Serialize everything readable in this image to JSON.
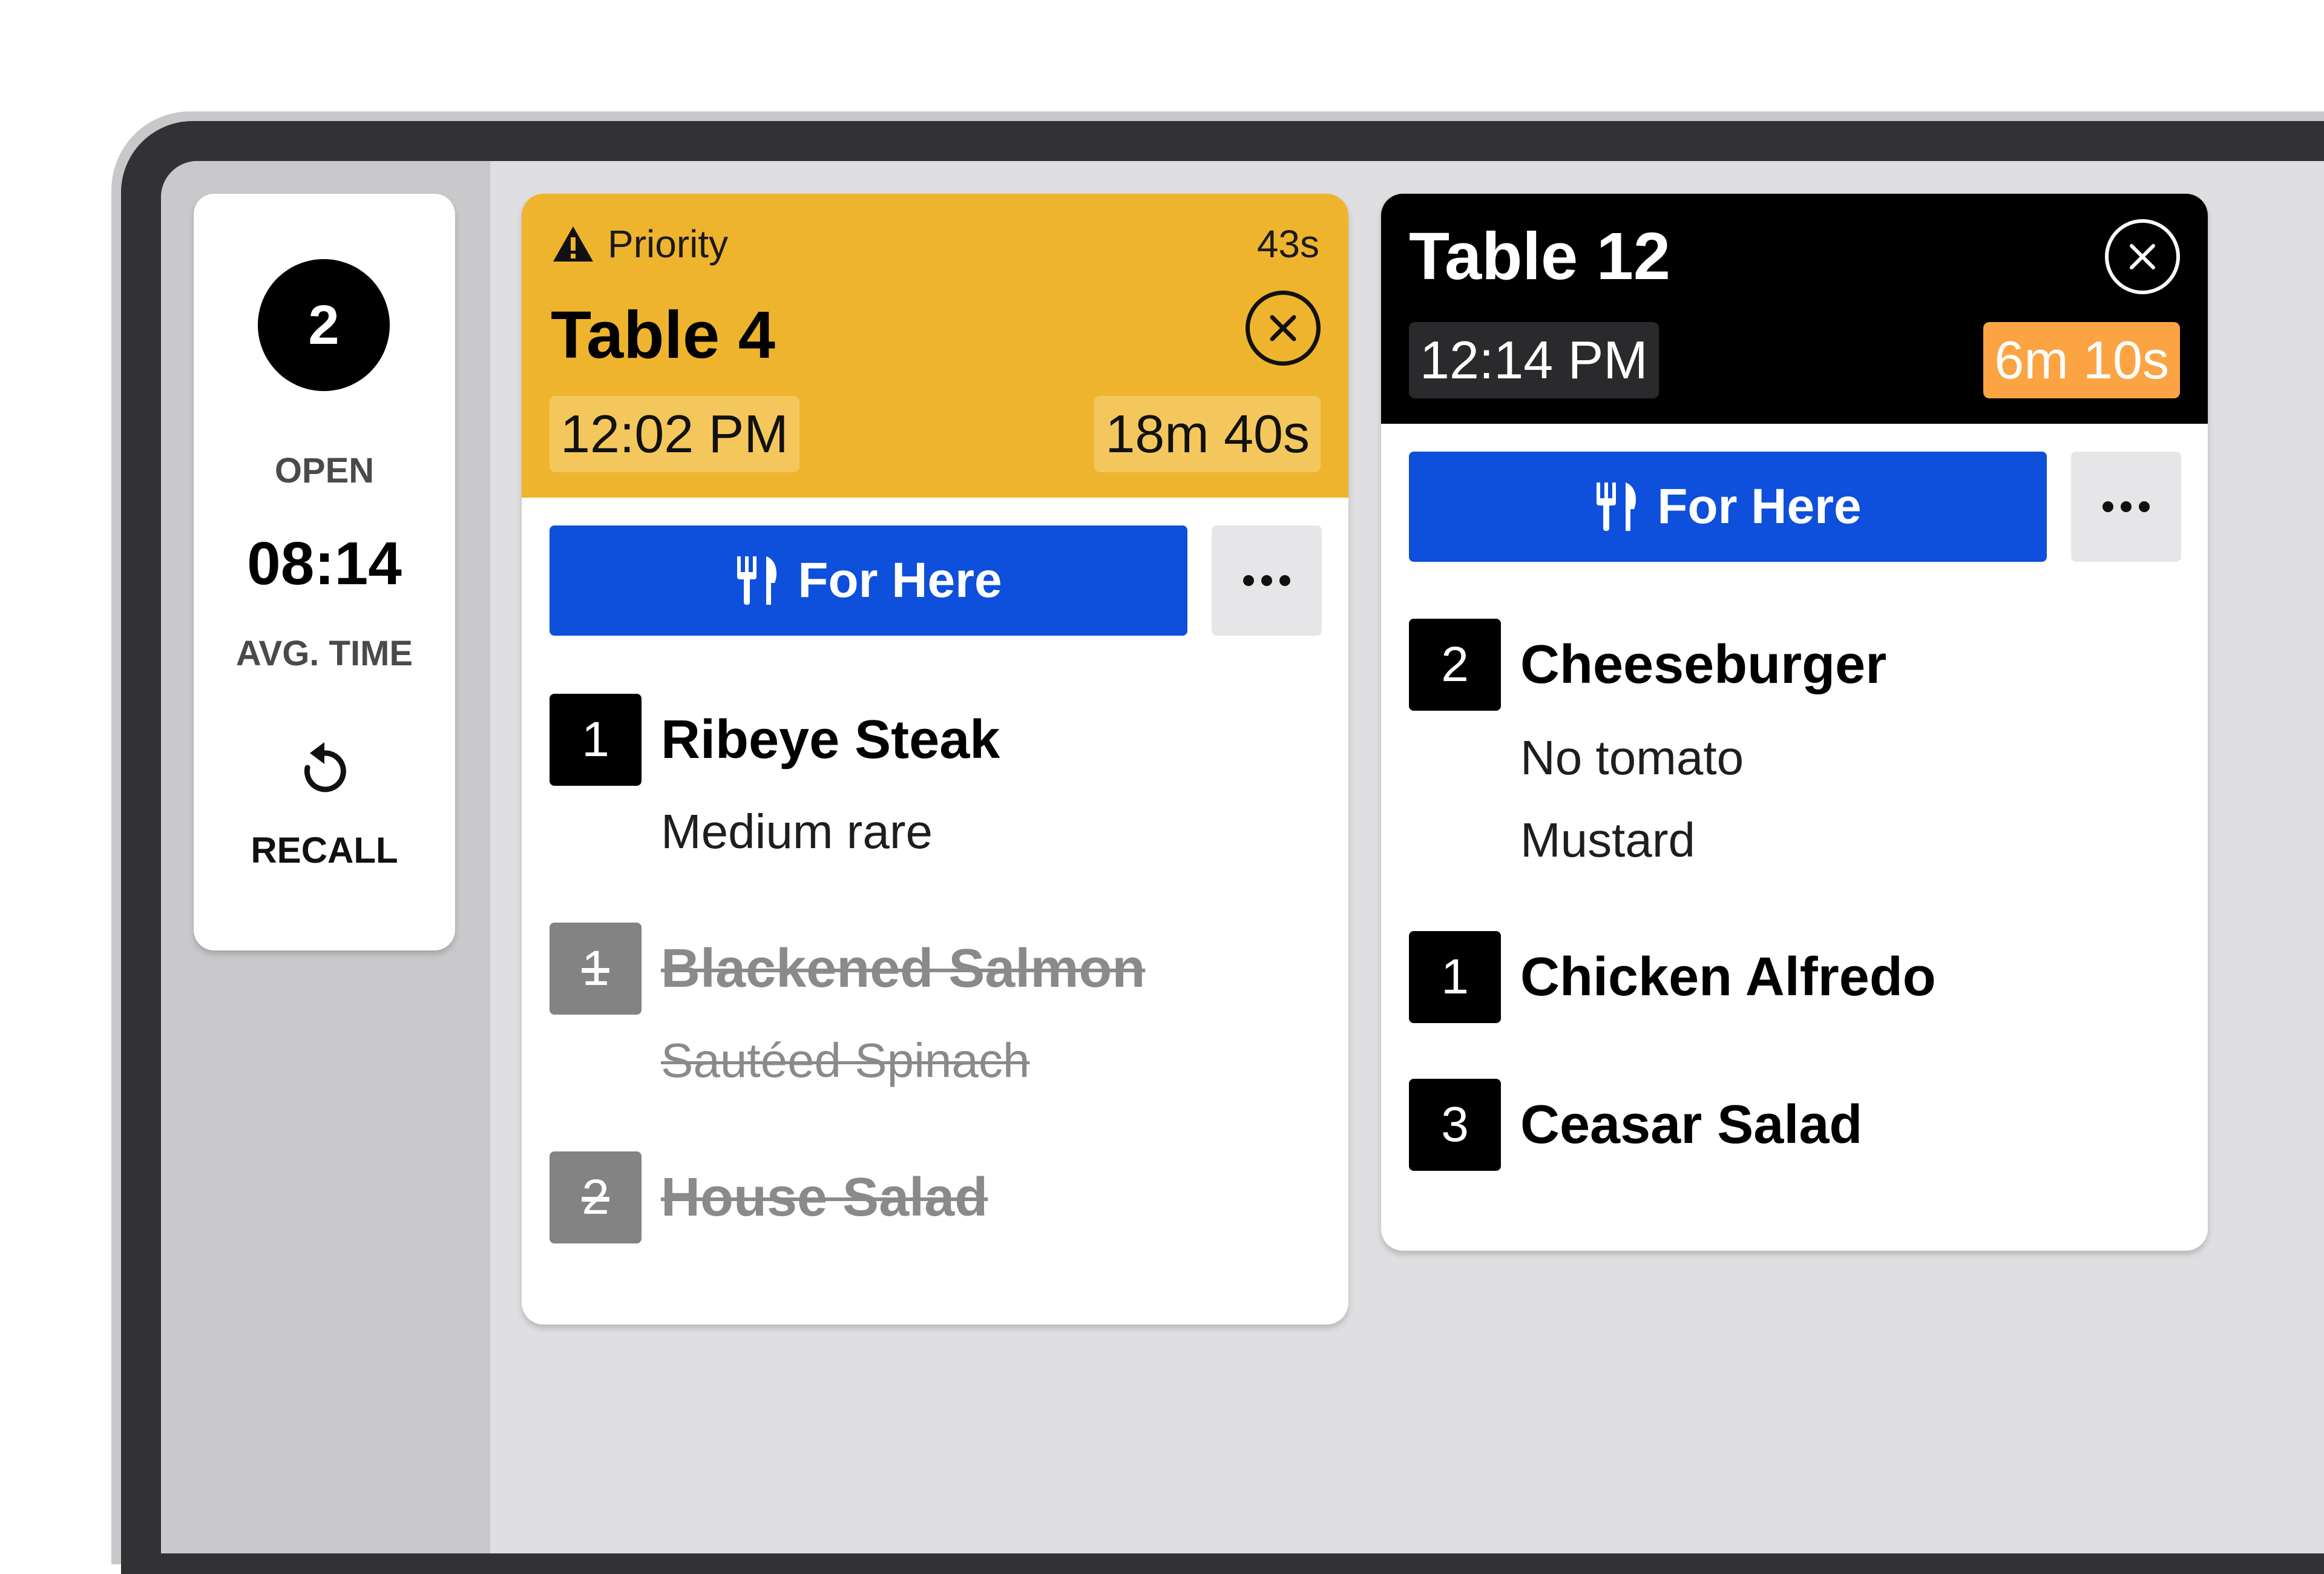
{
  "summary": {
    "open_count": "2",
    "open_label": "OPEN",
    "avg_time": "08:14",
    "avg_time_label": "AVG. TIME",
    "recall_label": "RECALL"
  },
  "tickets": [
    {
      "priority_label": "Priority",
      "elapsed_since_priority": "43s",
      "title": "Table 4",
      "order_time": "12:02 PM",
      "elapsed": "18m 40s",
      "dining_option": "For Here",
      "header_color": "#efb42e",
      "items": [
        {
          "qty": "1",
          "name": "Ribeye Steak",
          "modifiers": [
            "Medium rare"
          ],
          "status": "active"
        },
        {
          "qty": "1",
          "name": "Blackened Salmon",
          "modifiers": [
            "Sautéed Spinach"
          ],
          "status": "completed"
        },
        {
          "qty": "2",
          "name": "House Salad",
          "modifiers": [],
          "status": "completed"
        }
      ]
    },
    {
      "title": "Table 12",
      "order_time": "12:14 PM",
      "elapsed": "6m 10s",
      "dining_option": "For Here",
      "header_color": "#000000",
      "elapsed_color": "#fca443",
      "items": [
        {
          "qty": "2",
          "name": "Cheeseburger",
          "modifiers": [
            "No tomato",
            "Mustard"
          ],
          "status": "active"
        },
        {
          "qty": "1",
          "name": "Chicken Alfredo",
          "modifiers": [],
          "status": "active"
        },
        {
          "qty": "3",
          "name": "Ceasar Salad",
          "modifiers": [],
          "status": "active"
        }
      ]
    }
  ],
  "colors": {
    "accent_blue": "#0e4fdb",
    "priority_yellow": "#efb42e",
    "elapsed_warning": "#fca443",
    "completed_gray": "#838384"
  },
  "icons": {
    "priority": "warning-triangle-icon",
    "close": "close-circle-icon",
    "dining": "fork-knife-icon",
    "more": "more-dots-icon",
    "recall": "recall-arrow-icon"
  }
}
